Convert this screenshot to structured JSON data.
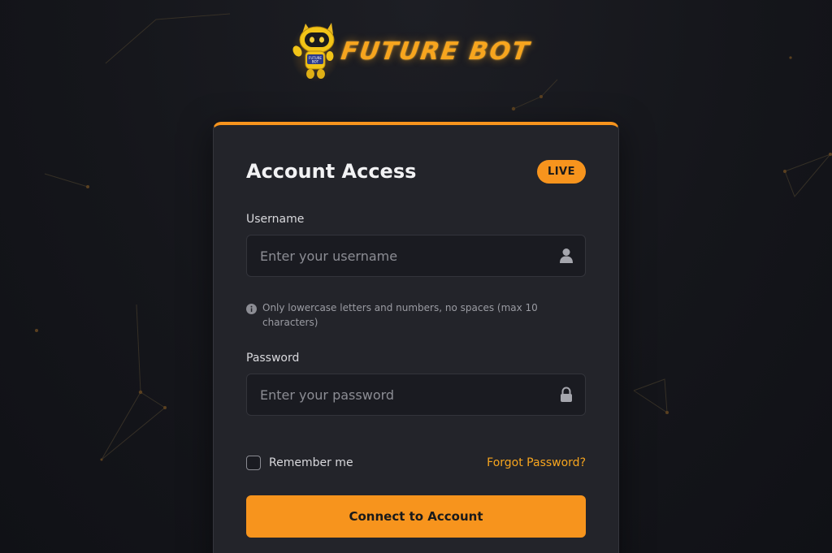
{
  "brand": {
    "name": "FUTURE BOT",
    "mascot_badge": "FUTURE BOT",
    "accent": "#f7941d"
  },
  "card": {
    "title": "Account Access",
    "badge": "LIVE",
    "username": {
      "label": "Username",
      "placeholder": "Enter your username",
      "value": "",
      "icon": "user-icon"
    },
    "hint": {
      "icon": "info-icon",
      "text": "Only lowercase letters and numbers, no spaces (max 10 characters)"
    },
    "password": {
      "label": "Password",
      "placeholder": "Enter your password",
      "value": "",
      "icon": "lock-icon"
    },
    "remember_label": "Remember me",
    "remember_checked": false,
    "forgot_label": "Forgot Password?",
    "submit_label": "Connect to Account"
  }
}
